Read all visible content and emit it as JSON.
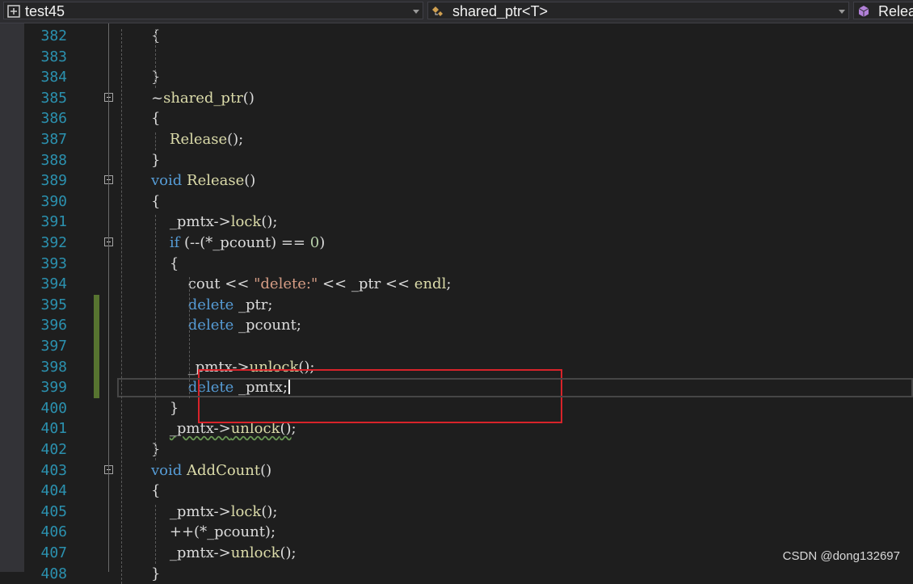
{
  "navigation_bar": {
    "project": {
      "label": "test45",
      "icon": "project-icon"
    },
    "scope": {
      "label": "shared_ptr<T>",
      "icon": "class-scope-icon"
    },
    "member": {
      "label": "Release",
      "icon": "method-cube-icon"
    }
  },
  "editor": {
    "lines": [
      {
        "n": "382",
        "tokens": [
          [
            "p",
            "{"
          ]
        ]
      },
      {
        "n": "383",
        "tokens": []
      },
      {
        "n": "384",
        "tokens": [
          [
            "p",
            "}"
          ]
        ]
      },
      {
        "n": "385",
        "tokens": [
          [
            "p",
            "~"
          ],
          [
            "fn",
            "shared_ptr"
          ],
          [
            "p",
            "()"
          ]
        ],
        "fold": true
      },
      {
        "n": "386",
        "tokens": [
          [
            "p",
            "{"
          ]
        ]
      },
      {
        "n": "387",
        "tokens": [
          [
            "p",
            "    "
          ],
          [
            "fn",
            "Release"
          ],
          [
            "p",
            "();"
          ]
        ]
      },
      {
        "n": "388",
        "tokens": [
          [
            "p",
            "}"
          ]
        ]
      },
      {
        "n": "389",
        "tokens": [
          [
            "kw",
            "void"
          ],
          [
            "p",
            " "
          ],
          [
            "fn",
            "Release"
          ],
          [
            "p",
            "()"
          ]
        ],
        "fold": true
      },
      {
        "n": "390",
        "tokens": [
          [
            "p",
            "{"
          ]
        ]
      },
      {
        "n": "391",
        "tokens": [
          [
            "p",
            "    _pmtx->"
          ],
          [
            "fn",
            "lock"
          ],
          [
            "p",
            "();"
          ]
        ]
      },
      {
        "n": "392",
        "tokens": [
          [
            "p",
            "    "
          ],
          [
            "kw",
            "if"
          ],
          [
            "p",
            " (--(*_pcount) == "
          ],
          [
            "num",
            "0"
          ],
          [
            "p",
            ")"
          ]
        ],
        "fold": true
      },
      {
        "n": "393",
        "tokens": [
          [
            "p",
            "    {"
          ]
        ]
      },
      {
        "n": "394",
        "tokens": [
          [
            "p",
            "        cout << "
          ],
          [
            "str",
            "\"delete:\""
          ],
          [
            "p",
            " << _ptr << "
          ],
          [
            "fn",
            "endl"
          ],
          [
            "p",
            ";"
          ]
        ]
      },
      {
        "n": "395",
        "tokens": [
          [
            "p",
            "        "
          ],
          [
            "kw",
            "delete"
          ],
          [
            "p",
            " _ptr;"
          ]
        ],
        "changed": true
      },
      {
        "n": "396",
        "tokens": [
          [
            "p",
            "        "
          ],
          [
            "kw",
            "delete"
          ],
          [
            "p",
            " _pcount;"
          ]
        ],
        "changed": true
      },
      {
        "n": "397",
        "tokens": [],
        "changed": true
      },
      {
        "n": "398",
        "tokens": [
          [
            "p",
            "        _pmtx->"
          ],
          [
            "fn",
            "unlock"
          ],
          [
            "p",
            "();"
          ]
        ],
        "changed": true
      },
      {
        "n": "399",
        "tokens": [
          [
            "p",
            "        "
          ],
          [
            "kw",
            "delete"
          ],
          [
            "p",
            " _pmtx;"
          ]
        ],
        "changed": true,
        "current": true
      },
      {
        "n": "400",
        "tokens": [
          [
            "p",
            "    }"
          ]
        ]
      },
      {
        "n": "401",
        "tokens": [
          [
            "p",
            "    "
          ],
          [
            "sq",
            "_pmtx->"
          ],
          [
            "sqfn",
            "unlock"
          ],
          [
            "sq",
            "()"
          ],
          [
            "p",
            ";"
          ]
        ]
      },
      {
        "n": "402",
        "tokens": [
          [
            "p",
            "}"
          ]
        ]
      },
      {
        "n": "403",
        "tokens": [
          [
            "kw",
            "void"
          ],
          [
            "p",
            " "
          ],
          [
            "fn",
            "AddCount"
          ],
          [
            "p",
            "()"
          ]
        ],
        "fold": true
      },
      {
        "n": "404",
        "tokens": [
          [
            "p",
            "{"
          ]
        ]
      },
      {
        "n": "405",
        "tokens": [
          [
            "p",
            "    _pmtx->"
          ],
          [
            "fn",
            "lock"
          ],
          [
            "p",
            "();"
          ]
        ]
      },
      {
        "n": "406",
        "tokens": [
          [
            "p",
            "    ++(*_pcount);"
          ]
        ]
      },
      {
        "n": "407",
        "tokens": [
          [
            "p",
            "    _pmtx->"
          ],
          [
            "fn",
            "unlock"
          ],
          [
            "p",
            "();"
          ]
        ]
      },
      {
        "n": "408",
        "tokens": [
          [
            "p",
            "}"
          ]
        ]
      }
    ]
  },
  "watermark": "CSDN @dong132697",
  "colors": {
    "background": "#1e1e1e",
    "line_number": "#2b91af",
    "keyword": "#569cd6",
    "function": "#dcdcaa",
    "string": "#d69d85",
    "number": "#b5cea8",
    "plain": "#dcdcdc",
    "annotation_box": "#d8232a",
    "change_bar": "#577430"
  }
}
